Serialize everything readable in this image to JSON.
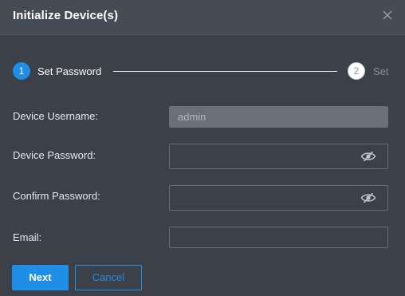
{
  "dialog": {
    "title": "Initialize Device(s)",
    "close_icon": "close-icon"
  },
  "steps": [
    {
      "number": "1",
      "label": "Set Password",
      "state": "active"
    },
    {
      "number": "2",
      "label": "Set",
      "state": "inactive"
    }
  ],
  "form": {
    "username": {
      "label": "Device Username:",
      "value": "admin",
      "disabled": true
    },
    "password": {
      "label": "Device Password:",
      "value": "",
      "icon": "eye-slash-icon"
    },
    "confirm": {
      "label": "Confirm Password:",
      "value": "",
      "icon": "eye-slash-icon"
    },
    "email": {
      "label": "Email:",
      "value": ""
    }
  },
  "buttons": {
    "next": "Next",
    "cancel": "Cancel"
  },
  "colors": {
    "accent": "#1f8ee6",
    "background": "#3b4049",
    "titlebar": "#464c56"
  }
}
